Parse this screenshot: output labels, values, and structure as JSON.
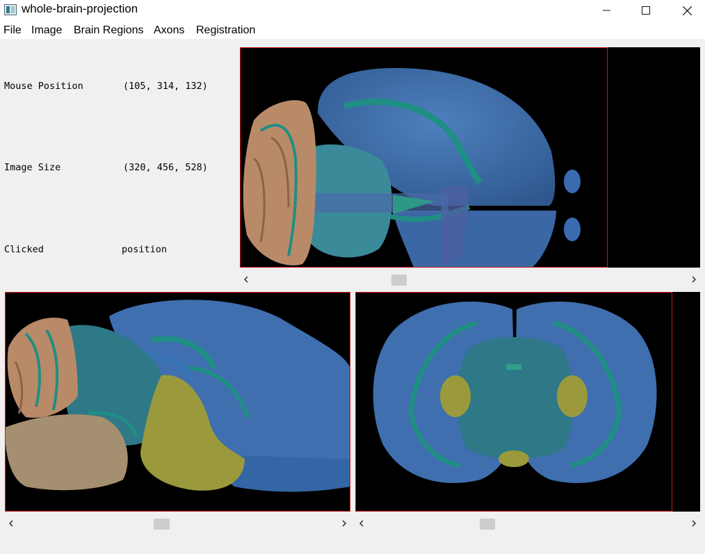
{
  "window": {
    "title": "whole-brain-projection",
    "icon": "app-icon"
  },
  "window_controls": [
    "minimize-icon",
    "maximize-icon",
    "close-icon"
  ],
  "menu": {
    "items": [
      "File",
      "Image",
      "Brain Regions",
      "Axons",
      "Registration"
    ]
  },
  "info": {
    "mouse_position_label": "Mouse Position",
    "mouse_position_value": "(105, 314, 132)",
    "image_size_label": "Image Size",
    "image_size_value": "(320, 456, 528)",
    "clicked_label": "Clicked",
    "clicked_value": "position"
  },
  "views": [
    {
      "name": "horizontal-view"
    },
    {
      "name": "sagittal-view"
    },
    {
      "name": "coronal-view"
    }
  ],
  "scrollbars": {
    "top_position": 0.34,
    "bottom_left_position": 0.45,
    "bottom_right_position": 0.39
  },
  "colors": {
    "cortex": "#3f6fae",
    "hippocampus": "#1f8e83",
    "cerebellum": "#b98a68",
    "brainstem": "#3b8a9a",
    "striatum": "#9a9a3c",
    "frame": "#d01818",
    "background": "#000000"
  }
}
